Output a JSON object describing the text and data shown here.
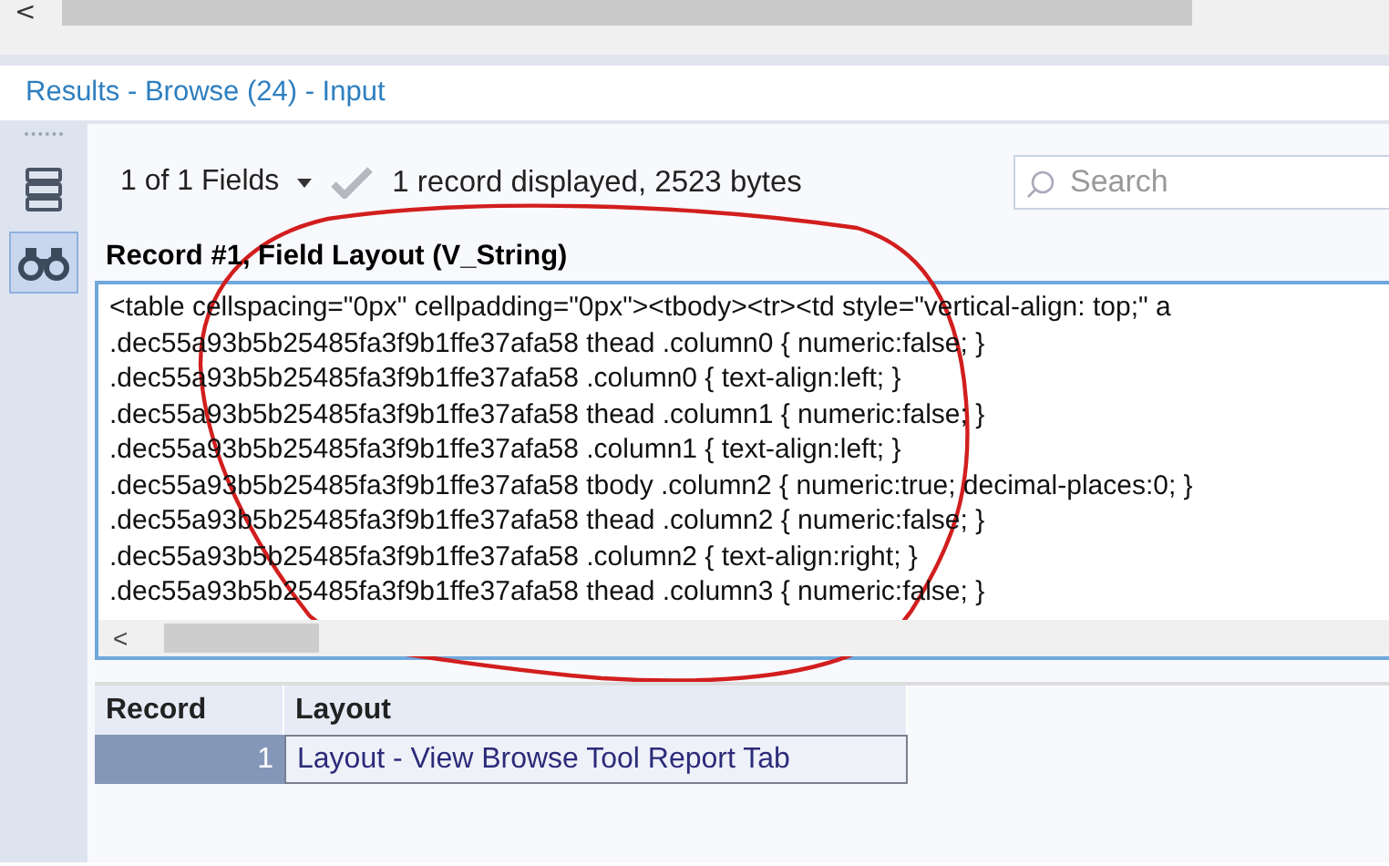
{
  "top_scrollbar": {
    "arrow": "<"
  },
  "results_header": "Results - Browse (24) - Input",
  "sidebar": {
    "items": [
      {
        "kind": "list",
        "selected": false
      },
      {
        "kind": "binoculars",
        "selected": true
      }
    ]
  },
  "toolbar": {
    "fields_dropdown": "1 of 1 Fields",
    "summary": "1 record displayed, 2523 bytes",
    "search": {
      "placeholder": "Search"
    }
  },
  "field_panel": {
    "title": "Record #1, Field Layout (V_String)",
    "lines": [
      "<table cellspacing=\"0px\" cellpadding=\"0px\"><tbody><tr><td style=\"vertical-align: top;\" a",
      ".dec55a93b5b25485fa3f9b1ffe37afa58 thead .column0 { numeric:false; }",
      ".dec55a93b5b25485fa3f9b1ffe37afa58 .column0 { text-align:left; }",
      ".dec55a93b5b25485fa3f9b1ffe37afa58 thead .column1 { numeric:false; }",
      ".dec55a93b5b25485fa3f9b1ffe37afa58 .column1 { text-align:left; }",
      ".dec55a93b5b25485fa3f9b1ffe37afa58 tbody .column2 { numeric:true; decimal-places:0; }",
      ".dec55a93b5b25485fa3f9b1ffe37afa58 thead .column2 { numeric:false; }",
      ".dec55a93b5b25485fa3f9b1ffe37afa58 .column2 { text-align:right; }",
      ".dec55a93b5b25485fa3f9b1ffe37afa58 thead .column3 { numeric:false; }"
    ],
    "scroll_arrow": "<"
  },
  "table": {
    "columns": [
      "Record",
      "Layout"
    ],
    "rows": [
      {
        "cells": [
          "1",
          "Layout - View Browse Tool Report Tab"
        ],
        "selected": true
      }
    ]
  }
}
